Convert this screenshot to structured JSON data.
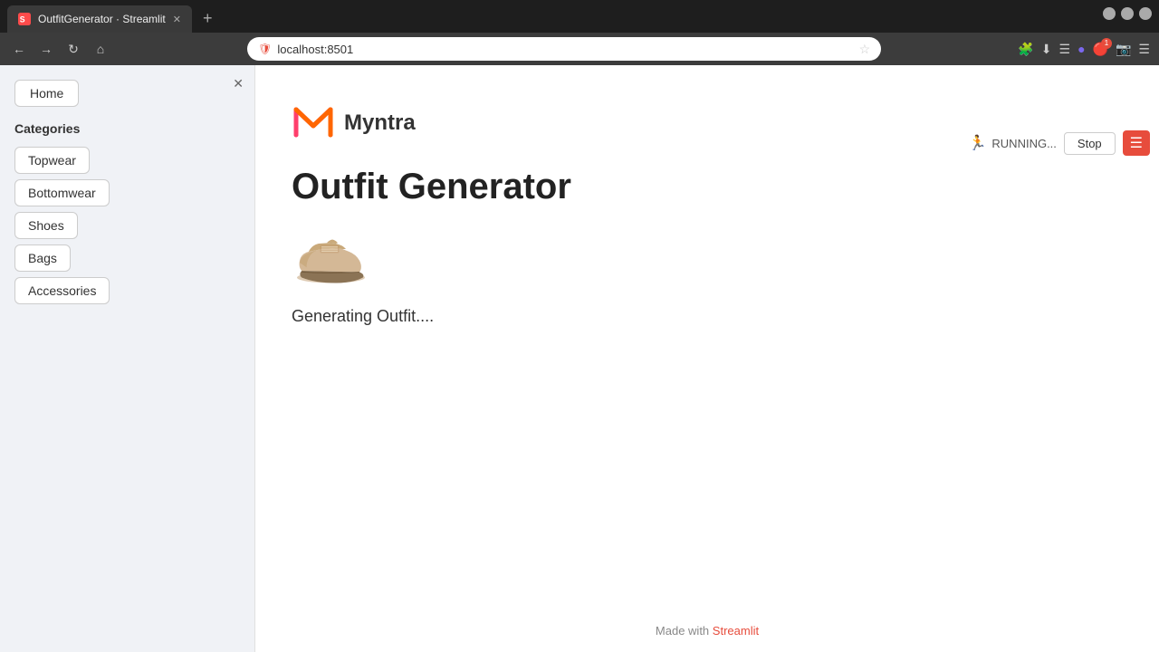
{
  "browser": {
    "tab_title": "OutfitGenerator · Streamlit",
    "tab_favicon": "ST",
    "url": "localhost:8501",
    "new_tab_symbol": "+",
    "nav_back": "←",
    "nav_forward": "→",
    "nav_refresh": "↻",
    "nav_home": "⌂"
  },
  "streamlit_toolbar": {
    "running_label": "RUNNING...",
    "stop_label": "Stop",
    "menu_symbol": "☰"
  },
  "sidebar": {
    "close_symbol": "✕",
    "home_label": "Home",
    "categories_title": "Categories",
    "nav_items": [
      {
        "label": "Topwear"
      },
      {
        "label": "Bottomwear"
      },
      {
        "label": "Shoes"
      },
      {
        "label": "Bags"
      },
      {
        "label": "Accessories"
      }
    ]
  },
  "main": {
    "brand_name": "Myntra",
    "page_title": "Outfit Generator",
    "generating_text": "Generating Outfit...."
  },
  "footer": {
    "prefix": "Made with ",
    "brand": "Streamlit"
  },
  "colors": {
    "accent_red": "#e74c3c",
    "myntra_pink": "#ff3f6c",
    "myntra_orange": "#ff6600"
  }
}
